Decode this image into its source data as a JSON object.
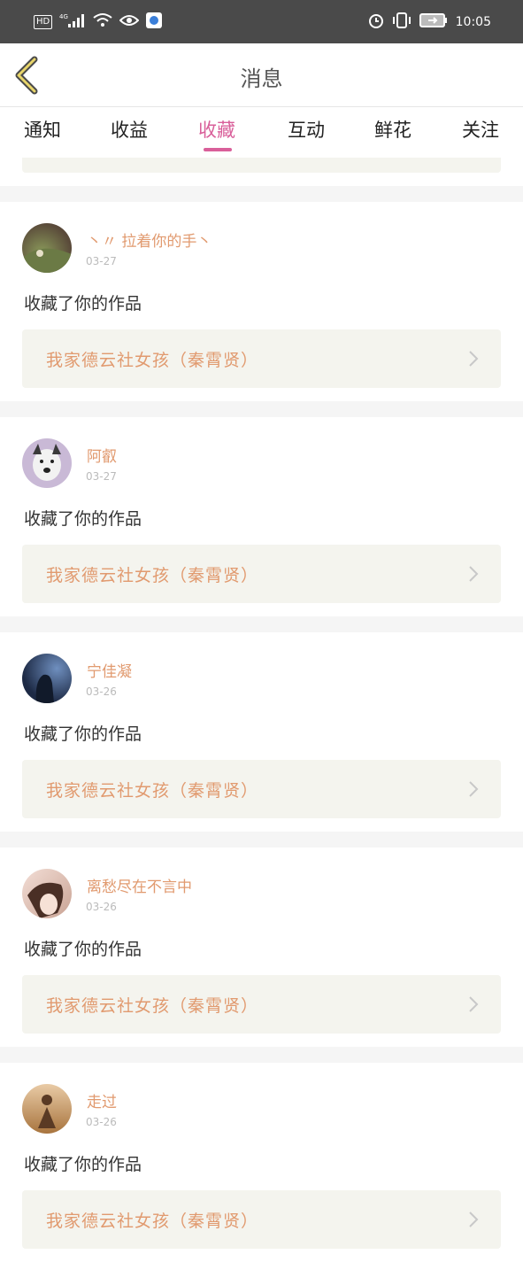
{
  "status_bar": {
    "left_badges": [
      "HD",
      "4G"
    ],
    "time": "10:05",
    "icons": [
      "hd-icon",
      "signal-icon",
      "wifi-icon",
      "eye-icon",
      "app-notify-icon",
      "alarm-icon",
      "vibrate-icon",
      "battery-icon"
    ]
  },
  "header": {
    "title": "消息",
    "back_icon": "chevron-left-icon"
  },
  "tabs": [
    {
      "label": "通知"
    },
    {
      "label": "收益"
    },
    {
      "label": "收藏"
    },
    {
      "label": "互动"
    },
    {
      "label": "鲜花"
    },
    {
      "label": "关注"
    }
  ],
  "active_tab": "收藏",
  "colors": {
    "accent": "#d95f9a",
    "name": "#e19a6f",
    "work_bg": "#f4f4ee",
    "status_bar": "#4a4a4a"
  },
  "items": [
    {
      "user": "丶〃 拉着你的手丶",
      "date": "03-27",
      "action": "收藏了你的作品",
      "work": "我家德云社女孩（秦霄贤）"
    },
    {
      "user": "阿叡",
      "date": "03-27",
      "action": "收藏了你的作品",
      "work": "我家德云社女孩（秦霄贤）"
    },
    {
      "user": "宁佳凝",
      "date": "03-26",
      "action": "收藏了你的作品",
      "work": "我家德云社女孩（秦霄贤）"
    },
    {
      "user": "离愁尽在不言中",
      "date": "03-26",
      "action": "收藏了你的作品",
      "work": "我家德云社女孩（秦霄贤）"
    },
    {
      "user": "走过",
      "date": "03-26",
      "action": "收藏了你的作品",
      "work": "我家德云社女孩（秦霄贤）"
    }
  ]
}
